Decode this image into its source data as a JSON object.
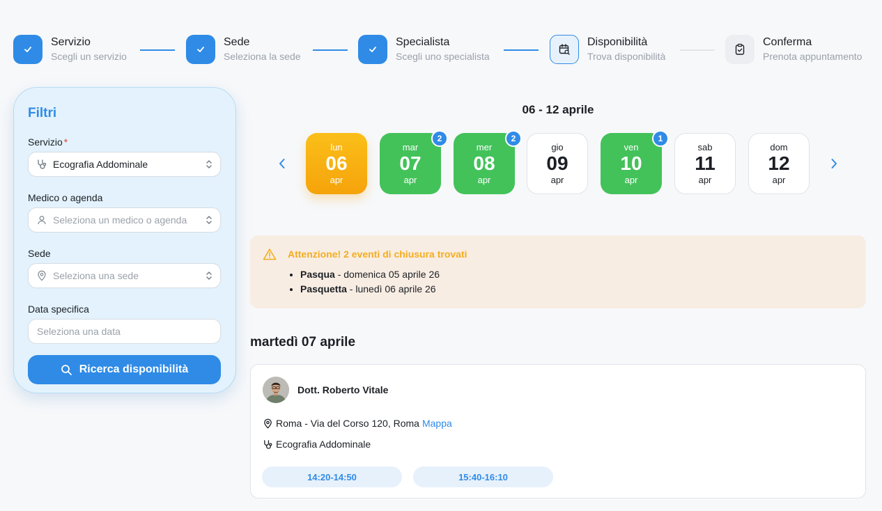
{
  "stepper": {
    "steps": [
      {
        "title": "Servizio",
        "subtitle": "Scegli un servizio",
        "state": "done",
        "icon": "check-icon"
      },
      {
        "title": "Sede",
        "subtitle": "Seleziona la sede",
        "state": "done",
        "icon": "check-icon"
      },
      {
        "title": "Specialista",
        "subtitle": "Scegli uno specialista",
        "state": "done",
        "icon": "check-icon"
      },
      {
        "title": "Disponibilità",
        "subtitle": "Trova disponibilità",
        "state": "active",
        "icon": "calendar-search-icon"
      },
      {
        "title": "Conferma",
        "subtitle": "Prenota appuntamento",
        "state": "pending",
        "icon": "clipboard-check-icon"
      }
    ]
  },
  "filters": {
    "title": "Filtri",
    "service": {
      "label": "Servizio",
      "required_mark": "*",
      "value": "Ecografia Addominale",
      "icon": "stethoscope-icon"
    },
    "doctor": {
      "label": "Medico o agenda",
      "placeholder": "Seleziona un medico o agenda",
      "icon": "user-icon"
    },
    "location": {
      "label": "Sede",
      "placeholder": "Seleziona una sede",
      "icon": "map-pin-icon"
    },
    "date": {
      "label": "Data specifica",
      "placeholder": "Seleziona una data"
    },
    "search_button": "Ricerca disponibilità"
  },
  "calendar": {
    "range": "06 - 12 aprile",
    "days": [
      {
        "dow": "lun",
        "num": "06",
        "month": "apr",
        "state": "selected",
        "badge": ""
      },
      {
        "dow": "mar",
        "num": "07",
        "month": "apr",
        "state": "available",
        "badge": "2"
      },
      {
        "dow": "mer",
        "num": "08",
        "month": "apr",
        "state": "available",
        "badge": "2"
      },
      {
        "dow": "gio",
        "num": "09",
        "month": "apr",
        "state": "empty",
        "badge": ""
      },
      {
        "dow": "ven",
        "num": "10",
        "month": "apr",
        "state": "available",
        "badge": "1"
      },
      {
        "dow": "sab",
        "num": "11",
        "month": "apr",
        "state": "empty",
        "badge": ""
      },
      {
        "dow": "dom",
        "num": "12",
        "month": "apr",
        "state": "empty",
        "badge": ""
      }
    ]
  },
  "alert": {
    "title": "Attenzione! 2 eventi di chiusura trovati",
    "items": [
      {
        "name": "Pasqua",
        "text": " - domenica 05 aprile 26"
      },
      {
        "name": "Pasquetta",
        "text": " - lunedì 06 aprile 26"
      }
    ]
  },
  "results": {
    "day_heading": "martedì 07 aprile",
    "doctor_name": "Dott. Roberto Vitale",
    "address": "Roma - Via del Corso 120, Roma",
    "map_link": "Mappa",
    "service": "Ecografia Addominale",
    "slots": [
      "14:20-14:50",
      "15:40-16:10"
    ]
  },
  "colors": {
    "primary": "#2f8be6",
    "available": "#43c25a",
    "selected": "#f5a30a",
    "warning": "#f3ad1e",
    "warning_bg": "#f8ede3",
    "filter_bg": "#e3f2fc"
  }
}
